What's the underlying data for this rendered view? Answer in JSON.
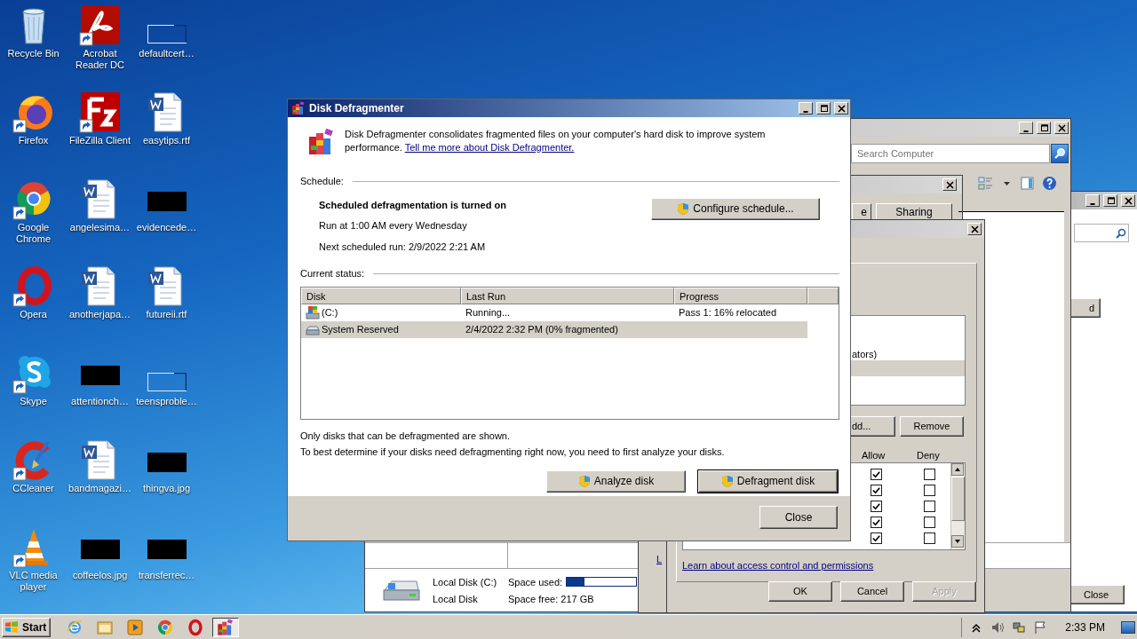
{
  "desktop_icons": [
    {
      "label": "Recycle Bin",
      "kind": "recycle-bin",
      "shortcut": false
    },
    {
      "label": "Firefox",
      "kind": "firefox",
      "shortcut": true
    },
    {
      "label": "Google Chrome",
      "kind": "chrome",
      "shortcut": true
    },
    {
      "label": "Opera",
      "kind": "opera",
      "shortcut": true
    },
    {
      "label": "Skype",
      "kind": "skype",
      "shortcut": true
    },
    {
      "label": "CCleaner",
      "kind": "ccleaner",
      "shortcut": true
    },
    {
      "label": "VLC media player",
      "kind": "vlc",
      "shortcut": true
    },
    {
      "label": "Acrobat Reader DC",
      "kind": "pdf",
      "shortcut": true
    },
    {
      "label": "FileZilla Client",
      "kind": "filezilla",
      "shortcut": true
    },
    {
      "label": "angelesima…",
      "kind": "document",
      "shortcut": false
    },
    {
      "label": "anotherjapa…",
      "kind": "document",
      "shortcut": false
    },
    {
      "label": "attentionch…",
      "kind": "hidden-thumbnail"
    },
    {
      "label": "bandmagazi…",
      "kind": "document",
      "shortcut": false
    },
    {
      "label": "coffeelos.jpg",
      "kind": "hidden-thumbnail"
    },
    {
      "label": "defaultcert…",
      "kind": "blank-thumbnail"
    },
    {
      "label": "easytips.rtf",
      "kind": "document",
      "shortcut": false
    },
    {
      "label": "evidencede…",
      "kind": "hidden-thumbnail"
    },
    {
      "label": "futureii.rtf",
      "kind": "document",
      "shortcut": false
    },
    {
      "label": "teensproble…",
      "kind": "blank-thumbnail"
    },
    {
      "label": "thingva.jpg",
      "kind": "hidden-thumbnail"
    },
    {
      "label": "transferrec…",
      "kind": "hidden-thumbnail"
    }
  ],
  "back_window": {
    "partial_button": "d",
    "close_button": "Close"
  },
  "explorer": {
    "search_placeholder": "Search Computer",
    "drive": {
      "name": "Local Disk (C:)",
      "type": "Local Disk",
      "space_used_label": "Space used:",
      "level": 0.25,
      "space_free": "Space free: 217 GB"
    }
  },
  "properties": {
    "tabs": [
      {
        "label": "e",
        "selected": false
      },
      {
        "label": "Sharing",
        "selected": false
      }
    ],
    "partial_link": "L"
  },
  "permissions": {
    "group_text": "ators)",
    "add_button": "dd...",
    "remove_button": "Remove",
    "columns": [
      "Allow",
      "Deny"
    ],
    "rows": [
      {
        "allow": true,
        "deny": false
      },
      {
        "allow": true,
        "deny": false
      },
      {
        "allow": true,
        "deny": false
      },
      {
        "allow": true,
        "deny": false
      },
      {
        "allow": true,
        "deny": false
      }
    ],
    "link": "Learn about access control and permissions",
    "buttons": [
      {
        "label": "OK",
        "disabled": false
      },
      {
        "label": "Cancel",
        "disabled": false
      },
      {
        "label": "Apply",
        "disabled": true
      }
    ]
  },
  "defragmenter": {
    "title": "Disk Defragmenter",
    "intro": "Disk Defragmenter consolidates fragmented files on your computer's hard disk to improve system performance.",
    "intro_link": "Tell me more about Disk Defragmenter.",
    "schedule_label": "Schedule:",
    "schedule_status": "Scheduled defragmentation is turned on",
    "schedule_run": "Run at 1:00 AM every Wednesday",
    "schedule_next": "Next scheduled run: 2/9/2022 2:21 AM",
    "configure_button": "Configure schedule...",
    "status_label": "Current status:",
    "columns": [
      "Disk",
      "Last Run",
      "Progress"
    ],
    "disks": [
      {
        "kind": "system",
        "name": "(C:)",
        "last_run": "Running...",
        "progress": "Pass 1: 16% relocated",
        "selected": false
      },
      {
        "kind": "drive",
        "name": "System Reserved",
        "last_run": "2/4/2022 2:32 PM (0% fragmented)",
        "selected": true
      }
    ],
    "notes": [
      "Only disks that can be defragmented are shown.",
      "To best determine if your disks need defragmenting right now, you need to first analyze your disks."
    ],
    "buttons": [
      {
        "label": "Analyze disk",
        "default": false
      },
      {
        "label": "Defragment disk",
        "default": true
      }
    ],
    "close_button": "Close"
  },
  "taskbar": {
    "start": "Start",
    "apps": [
      {
        "kind": "ie",
        "active": false
      },
      {
        "kind": "explorer",
        "active": false
      },
      {
        "kind": "media",
        "active": false
      },
      {
        "kind": "chrome",
        "active": false
      },
      {
        "kind": "opera",
        "active": false
      },
      {
        "kind": "defrag",
        "active": true
      }
    ],
    "clock": "2:33 PM"
  }
}
